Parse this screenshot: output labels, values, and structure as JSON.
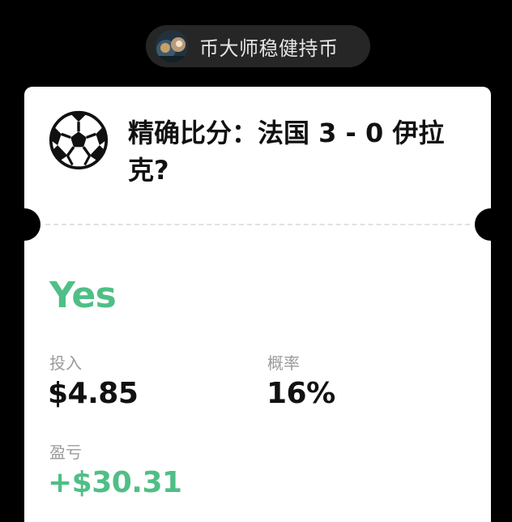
{
  "user": {
    "name": "币大师稳健持币",
    "avatar_icon": "user-avatar"
  },
  "bet": {
    "sport_icon": "soccer-ball-icon",
    "question": "精确比分：法国 3 - 0 伊拉克?",
    "outcome": "Yes",
    "stake_label": "投入",
    "stake_value": "$4.85",
    "probability_label": "概率",
    "probability_value": "16%",
    "pnl_label": "盈亏",
    "pnl_value": "+$30.31"
  },
  "colors": {
    "background": "#000000",
    "card": "#ffffff",
    "positive": "#4fbf86",
    "label": "#9b9b9b"
  }
}
